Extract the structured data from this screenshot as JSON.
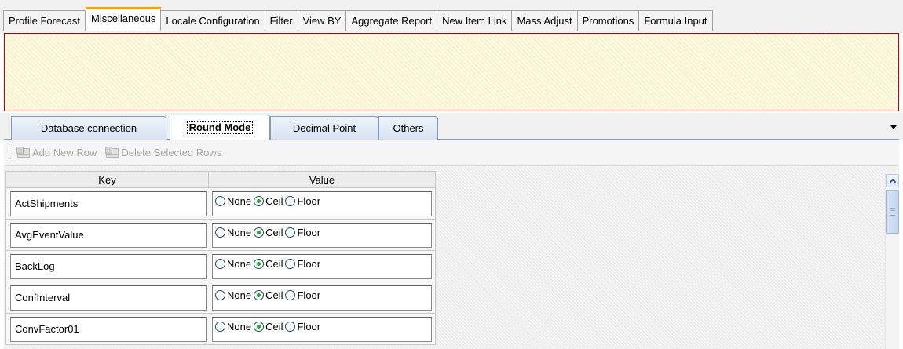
{
  "top_tabs": [
    {
      "label": "Profile Forecast",
      "active": false
    },
    {
      "label": "Miscellaneous",
      "active": true
    },
    {
      "label": "Locale Configuration",
      "active": false
    },
    {
      "label": "Filter",
      "active": false
    },
    {
      "label": "View BY",
      "active": false
    },
    {
      "label": "Aggregate Report",
      "active": false
    },
    {
      "label": "New Item Link",
      "active": false
    },
    {
      "label": "Mass Adjust",
      "active": false
    },
    {
      "label": "Promotions",
      "active": false
    },
    {
      "label": "Formula Input",
      "active": false
    }
  ],
  "inner_tabs": [
    {
      "label": "Database connection",
      "active": false
    },
    {
      "label": "Round Mode",
      "active": true
    },
    {
      "label": "Decimal Point",
      "active": false
    },
    {
      "label": "Others",
      "active": false
    }
  ],
  "toolbar": {
    "add_label": "Add New Row",
    "delete_label": "Delete Selected Rows"
  },
  "grid": {
    "headers": {
      "key": "Key",
      "value": "Value"
    },
    "options": [
      "None",
      "Ceil",
      "Floor"
    ],
    "rows": [
      {
        "key": "ActShipments",
        "selected": "Ceil"
      },
      {
        "key": "AvgEventValue",
        "selected": "Ceil"
      },
      {
        "key": "BackLog",
        "selected": "Ceil"
      },
      {
        "key": "ConfInterval",
        "selected": "Ceil"
      },
      {
        "key": "ConvFactor01",
        "selected": "Ceil"
      }
    ]
  },
  "colors": {
    "active_tab_accent": "#f4a300",
    "message_panel_border": "#c00000",
    "message_panel_bg": "#fffbe6"
  }
}
